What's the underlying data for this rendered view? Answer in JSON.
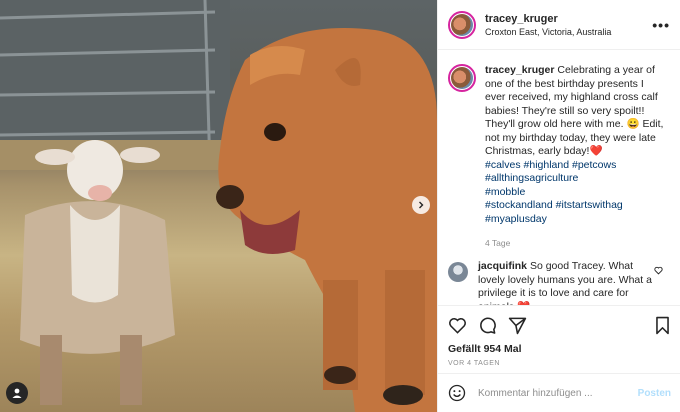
{
  "header": {
    "username": "tracey_kruger",
    "location": "Croxton East, Victoria, Australia",
    "more_icon": "more-horizontal-icon"
  },
  "caption": {
    "username": "tracey_kruger",
    "text": "Celebrating a year of one of the best birthday presents I ever received, my highland cross calf babies! They're still so very spoilt!! They'll grow old here with me. 😀 Edit, not my birthday today, they were late Christmas, early bday!❤️",
    "hashtags": [
      "#calves",
      "#highland",
      "#petcows",
      "#allthingsagriculture",
      "#mobble",
      "#stockandland",
      "#itstartswithag",
      "#myaplusday"
    ],
    "age": "4 Tage"
  },
  "comment": {
    "username": "jacquifink",
    "text": "So good Tracey. What lovely lovely humans you are. What a privilege it is to love and care for animals ❤️"
  },
  "actions": {
    "likes": "Gefällt 954 Mal",
    "date": "VOR 4 TAGEN"
  },
  "add_comment": {
    "placeholder": "Kommentar hinzufügen ...",
    "post_label": "Posten"
  },
  "colors": {
    "link": "#00376b",
    "text": "#262626",
    "muted": "#8e8e8e",
    "post_disabled": "#b2dffc"
  }
}
